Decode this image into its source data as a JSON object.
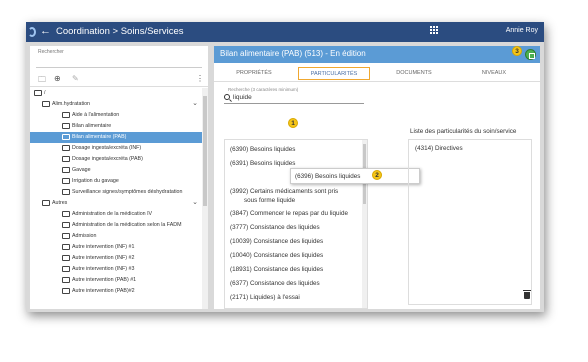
{
  "topbar": {
    "back_glyph": "←",
    "breadcrumb": "Coordination > Soins/Services",
    "user": "Annie Roy"
  },
  "left": {
    "search_label": "Rechercher",
    "tools": {
      "folder": "🗀",
      "add": "⊕",
      "edit": "✎",
      "more": "⋮"
    },
    "root_label": "/",
    "tree": [
      {
        "label": "Alim.hydratation",
        "level": 1,
        "expanded": true
      },
      {
        "label": "Aide à l'alimentation",
        "level": 2
      },
      {
        "label": "Bilan alimentaire",
        "level": 2
      },
      {
        "label": "Bilan alimentaire (PAB)",
        "level": 2,
        "selected": true
      },
      {
        "label": "Dosage ingesta/excréta (INF)",
        "level": 2
      },
      {
        "label": "Dosage ingesta/excréta (PAB)",
        "level": 2
      },
      {
        "label": "Gavage",
        "level": 2
      },
      {
        "label": "Irrigation du gavage",
        "level": 2
      },
      {
        "label": "Surveillance signes/symptômes déshydratation",
        "level": 2
      },
      {
        "label": "Autres",
        "level": 1,
        "expanded": true
      },
      {
        "label": "Administration de la médication IV",
        "level": 2
      },
      {
        "label": "Administration de la médication selon la FADM",
        "level": 2
      },
      {
        "label": "Admission",
        "level": 2
      },
      {
        "label": "Autre intervention (INF) #1",
        "level": 2
      },
      {
        "label": "Autre intervention (INF) #2",
        "level": 2
      },
      {
        "label": "Autre intervention (INF) #3",
        "level": 2
      },
      {
        "label": "Autre intervention (PAB) #1",
        "level": 2
      },
      {
        "label": "Autre intervention (PAB)#2",
        "level": 2
      }
    ]
  },
  "right": {
    "title": "Bilan alimentaire (PAB) (513) - En édition",
    "tabs": [
      "PROPRIÉTÉS",
      "PARTICULARITÉS",
      "DOCUMENTS",
      "NIVEAUX"
    ],
    "active_tab": 1,
    "search_label": "Recherche (3 caractères minimum)",
    "search_value": "liquide",
    "results": [
      "(6390) Besoins liquides",
      "(6391) Besoins liquides",
      "(3992) Certains médicaments sont pris",
      "sous forme liquide",
      "(3847) Commencer le repas par du liquide",
      "(3777) Consistance des liquides",
      "(10039) Consistance des liquides",
      "(10040) Consistance des liquides",
      "(18931) Consistance des liquides",
      "(6377) Consistance des liquides",
      "(2171) Liquides) à l'essai"
    ],
    "drag_item": "(6396) Besoins liquides",
    "particularites_label": "Liste des particularités du soin/service",
    "particularites": [
      "(4314) Directives"
    ]
  },
  "badges": [
    "1",
    "2",
    "3"
  ],
  "colors": {
    "topbar": "#2b4c80",
    "accent": "#5b9bd5",
    "tab_highlight": "#f0a830",
    "badge": "#f5c518",
    "save": "#4caf50"
  }
}
